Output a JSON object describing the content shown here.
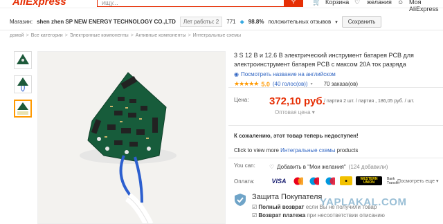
{
  "header": {
    "logo": "AliExpress",
    "search_placeholder": "ищу...",
    "cart": "Корзина",
    "wishlist": "желания",
    "account": "Моя AliExpress"
  },
  "store": {
    "label": "Магазин:",
    "name": "shen zhen SP NEW ENERGY TECHNOLOGY CO.,LTD",
    "years": "Лет работы: 2",
    "score": "771",
    "positive_pct": "98.8%",
    "positive_label": "положительных отзывов",
    "save_label": "Сохранить"
  },
  "breadcrumb": [
    "домой",
    "Все категории",
    "Электронные компоненты",
    "Активные компоненты",
    "Интегральные схемы"
  ],
  "product": {
    "title": "3 S 12 В и 12.6 В электрический инструмент батарея PCB для электроинструмент батарея PCB с максом 20A ток разряда",
    "view_english": "Посмотреть название на английском",
    "rating": "5.0",
    "reviews": "(40 голос(ов))",
    "orders": "70 заказа(ов)",
    "price_label": "Цена:",
    "price": "372,10 руб.",
    "price_unit": "/ партия 2 шт. / партия , 186,05 руб. / шт.",
    "wholesale": "Оптовая цена"
  },
  "notice": {
    "unavailable": "К сожалению, этот товар теперь недоступен!",
    "view_more_prefix": "Click to view more",
    "view_more_link": "Интегральные схемы",
    "view_more_suffix": "products"
  },
  "actions": {
    "you_can": "You can:",
    "add_wishlist": "Добавить в \"Мои желания\"",
    "wishlist_count": "(124 добавили)"
  },
  "payment": {
    "label": "Оплата:",
    "methods": [
      "VISA",
      "MC",
      "MC",
      "Maestro",
      "WESTERN UNION",
      "Bank Transfer"
    ],
    "more": "Посмотреть еще"
  },
  "buyer_protection": {
    "title": "Защита Покупателя",
    "line1_bold": "Полный возврат",
    "line1_rest": "если Вы не получили товар",
    "line2_bold": "Возврат платежа",
    "line2_rest": "при несоответствии описанию"
  },
  "watermark": "YAPLAKAL.COM",
  "colors": {
    "accent": "#e62e04",
    "link": "#2f64c2",
    "star": "#ff9900"
  }
}
